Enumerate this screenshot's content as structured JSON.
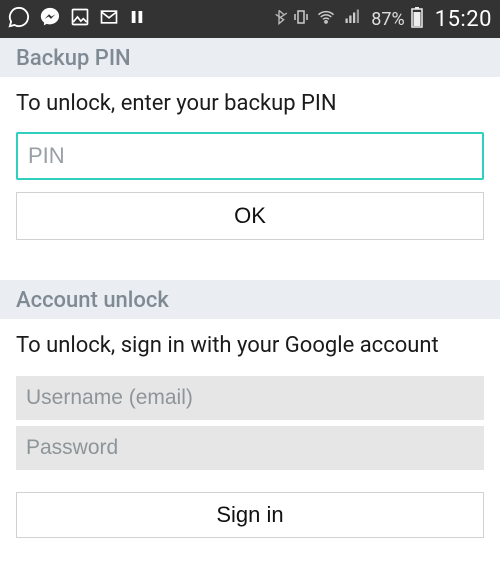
{
  "status_bar": {
    "battery_pct": "87%",
    "clock": "15:20"
  },
  "backup_pin": {
    "header": "Backup PIN",
    "instruction": "To unlock, enter your backup PIN",
    "placeholder": "PIN",
    "ok_label": "OK"
  },
  "account_unlock": {
    "header": "Account unlock",
    "instruction": "To unlock, sign in with your Google account",
    "username_placeholder": "Username (email)",
    "password_placeholder": "Password",
    "signin_label": "Sign in"
  }
}
